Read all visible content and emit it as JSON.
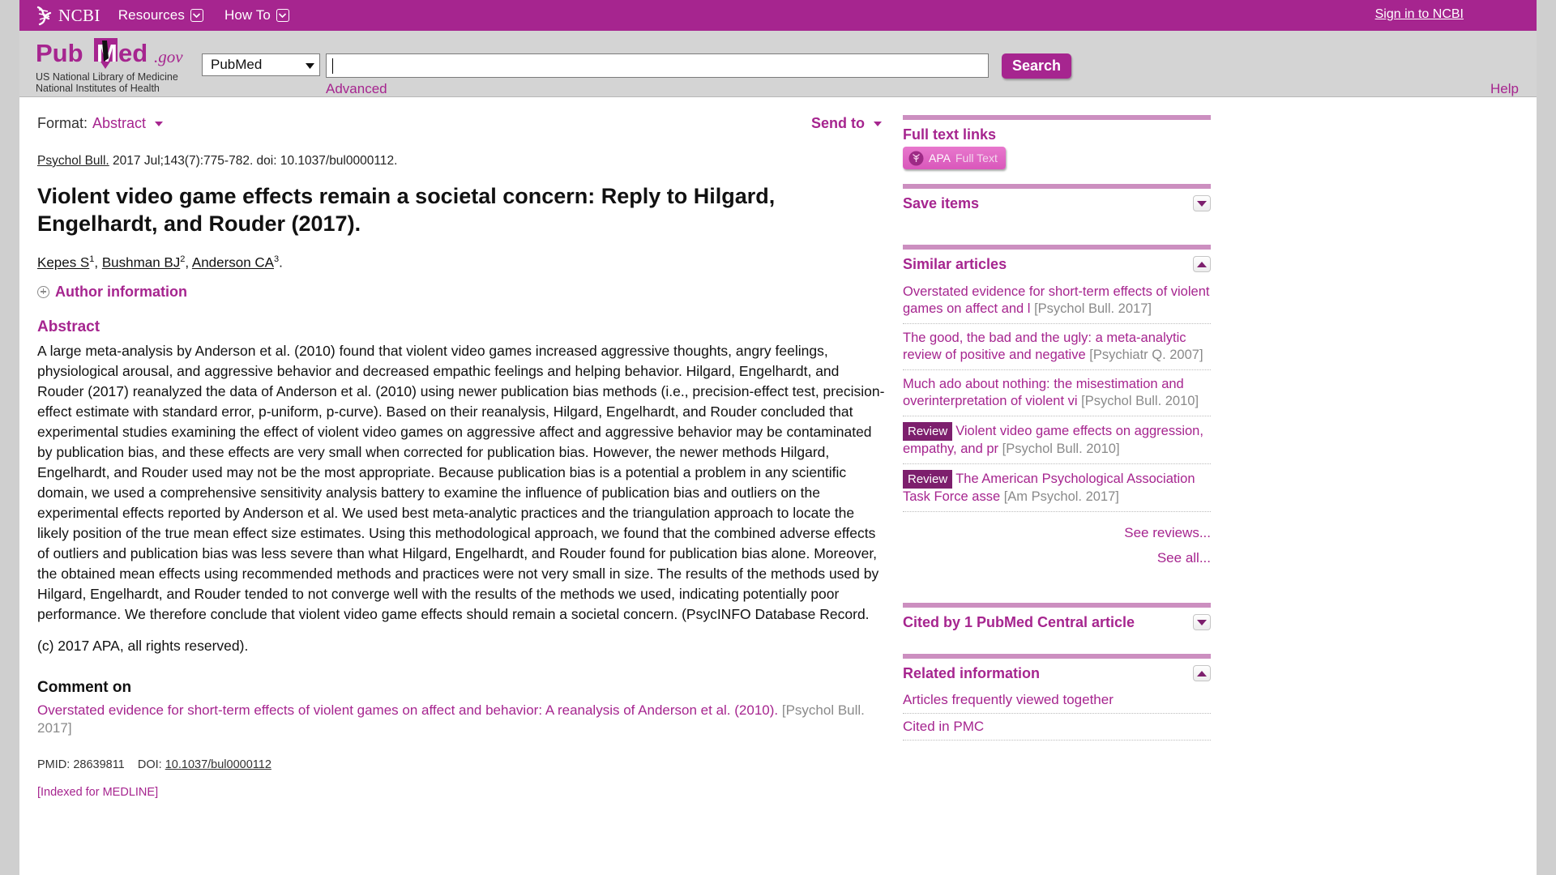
{
  "topbar": {
    "brand": "NCBI",
    "nav": [
      {
        "label": "Resources",
        "icon": "chevron-down-icon"
      },
      {
        "label": "How To",
        "icon": "chevron-down-icon"
      }
    ],
    "signin": "Sign in to NCBI",
    "bar_color": "#a6258f"
  },
  "header": {
    "logo_text": "PubMed",
    "logo_suffix": ".gov",
    "subtitle_line1": "US National Library of Medicine",
    "subtitle_line2": "National Institutes of Health",
    "database": "PubMed",
    "search_value": "",
    "search_placeholder": "",
    "search_button": "Search",
    "advanced": "Advanced",
    "help": "Help"
  },
  "toolbar": {
    "format_label": "Format:",
    "format_value": "Abstract",
    "send_to": "Send to"
  },
  "article": {
    "journal": "Psychol Bull.",
    "citation_rest": " 2017 Jul;143(7):775-782. doi: 10.1037/bul0000112.",
    "title": "Violent video game effects remain a societal concern: Reply to Hilgard, Engelhardt, and Rouder (2017).",
    "authors": [
      {
        "name": "Kepes S",
        "sup": "1"
      },
      {
        "name": "Bushman BJ",
        "sup": "2"
      },
      {
        "name": "Anderson CA",
        "sup": "3"
      }
    ],
    "author_information": "Author information",
    "abstract_heading": "Abstract",
    "abstract_paragraph_1": "A large meta-analysis by Anderson et al. (2010) found that violent video games increased aggressive thoughts, angry feelings, physiological arousal, and aggressive behavior and decreased empathic feelings and helping behavior. Hilgard, Engelhardt, and Rouder (2017) reanalyzed the data of Anderson et al. (2010) using newer publication bias methods (i.e., precision-effect test, precision-effect estimate with standard error, p-uniform, p-curve). Based on their reanalysis, Hilgard, Engelhardt, and Rouder concluded that experimental studies examining the effect of violent video games on aggressive affect and aggressive behavior may be contaminated by publication bias, and these effects are very small when corrected for publication bias. However, the newer methods Hilgard, Engelhardt, and Rouder used may not be the most appropriate. Because publication bias is a potential a problem in any scientific domain, we used a comprehensive sensitivity analysis battery to examine the influence of publication bias and outliers on the experimental effects reported by Anderson et al. We used best meta-analytic practices and the triangulation approach to locate the likely position of the true mean effect size estimates. Using this methodological approach, we found that the combined adverse effects of outliers and publication bias was less severe than what Hilgard, Engelhardt, and Rouder found for publication bias alone. Moreover, the obtained mean effects using recommended methods and practices were not very small in size. The results of the methods used by Hilgard, Engelhardt, and Rouder tended to not converge well with the results of the methods we used, indicating potentially poor performance. We therefore conclude that violent video game effects should remain a societal concern. (PsycINFO Database Record.",
    "abstract_paragraph_2": "(c) 2017 APA, all rights reserved).",
    "comment_on_heading": "Comment on",
    "comment_on_title": "Overstated evidence for short-term effects of violent games on affect and behavior: A reanalysis of Anderson et al. (2010).",
    "comment_on_jref": "[Psychol Bull. 2017]",
    "pmid_label": "PMID:",
    "pmid_value": "28639811",
    "doi_label": "DOI:",
    "doi_value": "10.1037/bul0000112",
    "indexed": "[Indexed for MEDLINE]"
  },
  "sidebar": {
    "full_text_links": {
      "title": "Full text links",
      "button_primary": "APA",
      "button_secondary": "Full Text",
      "icon": "apa-tree-icon"
    },
    "save_items": {
      "title": "Save items",
      "toggle": "chevron-down-icon"
    },
    "similar_articles": {
      "title": "Similar articles",
      "toggle": "chevron-up-icon",
      "items": [
        {
          "badge": "",
          "title": "Overstated evidence for short-term effects of violent games on affect and l",
          "jref": "[Psychol Bull. 2017]"
        },
        {
          "badge": "",
          "title": "The good, the bad and the ugly: a meta-analytic review of positive and negative",
          "jref": "[Psychiatr Q. 2007]"
        },
        {
          "badge": "",
          "title": "Much ado about nothing: the misestimation and overinterpretation of violent vi",
          "jref": "[Psychol Bull. 2010]"
        },
        {
          "badge": "Review",
          "title": "Violent video game effects on aggression, empathy, and pr",
          "jref": "[Psychol Bull. 2010]"
        },
        {
          "badge": "Review",
          "title": "The American Psychological Association Task Force asse",
          "jref": "[Am Psychol. 2017]"
        }
      ],
      "see_reviews": "See reviews...",
      "see_all": "See all..."
    },
    "cited_by": {
      "title": "Cited by 1 PubMed Central article",
      "toggle": "chevron-down-icon"
    },
    "related_information": {
      "title": "Related information",
      "toggle": "chevron-up-icon",
      "items": [
        "Articles frequently viewed together",
        "Cited in PMC"
      ]
    }
  }
}
